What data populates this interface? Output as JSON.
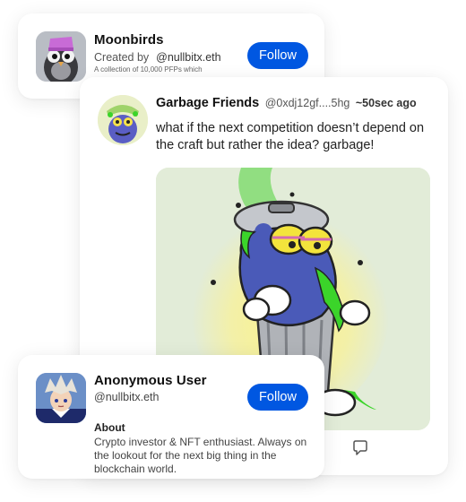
{
  "moonbirds_card": {
    "title": "Moonbirds",
    "created_by_label": "Created by",
    "creator_handle": "@nullbitx.eth",
    "description": "A collection of 10,000 PFPs which",
    "follow_label": "Follow",
    "icons": {
      "avatar": "moonbird-owl-avatar"
    }
  },
  "post": {
    "author_name": "Garbage Friends",
    "author_handle": "@0xdj12gf....5hg",
    "timestamp": "~50sec ago",
    "text": "what if the next competition doesn’t depend on the craft but rather the idea? garbage!",
    "icons": {
      "avatar": "garbage-monster-avatar",
      "image": "garbage-can-monster-illustration",
      "reply": "reply-bubble-icon"
    }
  },
  "user_card": {
    "name": "Anonymous User",
    "handle": "@nullbitx.eth",
    "follow_label": "Follow",
    "about_label": "About",
    "about_text": "Crypto investor & NFT enthusiast. Always on the lookout for the next big thing in the blockchain world.",
    "icons": {
      "avatar": "anime-boy-avatar"
    }
  },
  "colors": {
    "follow_button": "#0057e1",
    "slime_green": "#3bd42a",
    "monster_blue": "#4a5ab8"
  }
}
